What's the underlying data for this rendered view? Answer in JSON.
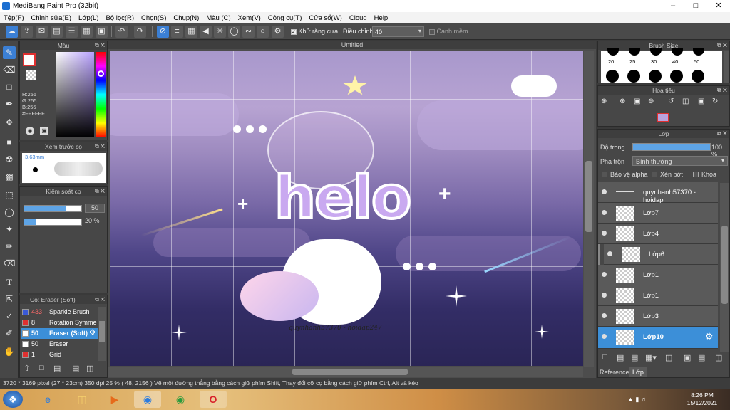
{
  "window": {
    "title": "MediBang Paint Pro (32bit)"
  },
  "menu": [
    "Tệp(F)",
    "Chỉnh sửa(E)",
    "Lớp(L)",
    "Bộ lọc(R)",
    "Chọn(S)",
    "Chụp(N)",
    "Màu (C)",
    "Xem(V)",
    "Công cụ(T)",
    "Cửa sổ(W)",
    "Cloud",
    "Help"
  ],
  "toolbar": {
    "antialias_label": "Khử răng cưa",
    "adjust_label": "Điều chỉnh",
    "adjust_value": "40",
    "snap_label": "Cạnh mềm"
  },
  "color_panel": {
    "title": "Màu",
    "r": "R:255",
    "g": "G:255",
    "b": "B:255",
    "hex": "#FFFFFF",
    "accent": "#e03030"
  },
  "brush_preview": {
    "title": "Xem trước cọ",
    "size": "3.63mm"
  },
  "brush_control": {
    "title": "Kiểm soát cọ",
    "size_value": "50",
    "opacity_value": "20 %"
  },
  "brush_list": {
    "title": "Cọ: Eraser (Soft)",
    "items": [
      {
        "size": "433",
        "name": "Sparkle Brush",
        "color": "#3a5ad8"
      },
      {
        "size": "8",
        "name": "Rotation Symme",
        "color": "#e03030"
      },
      {
        "size": "50",
        "name": "Eraser (Soft)",
        "color": "#ffffff",
        "selected": true
      },
      {
        "size": "50",
        "name": "Eraser",
        "color": "#ffffff"
      },
      {
        "size": "1",
        "name": "Grid",
        "color": "#e03030"
      }
    ]
  },
  "canvas": {
    "title": "Untitled",
    "art_text": "helo",
    "watermark": "quynhanh57370 - hoidap247"
  },
  "brush_size": {
    "title": "Brush Size",
    "sizes": [
      "20",
      "25",
      "30",
      "40",
      "50"
    ]
  },
  "navigator": {
    "title": "Hoa tiêu"
  },
  "layers_panel": {
    "title": "Lớp",
    "opacity_label": "Độ trong",
    "opacity_value": "100 %",
    "opacity_fraction": 1.0,
    "blend_label": "Pha trộn",
    "blend_value": "Bình thường",
    "protect_alpha": "Bảo vệ alpha",
    "clip": "Xén bớt",
    "lock": "Khóa",
    "layers": [
      {
        "name": "quynhanh57370 - hoidap",
        "selected": false
      },
      {
        "name": "Lớp7",
        "selected": false
      },
      {
        "name": "Lớp4",
        "selected": false
      },
      {
        "name": "Lớp6",
        "selected": false
      },
      {
        "name": "Lớp1",
        "selected": false
      },
      {
        "name": "Lớp1",
        "selected": false
      },
      {
        "name": "Lớp3",
        "selected": false
      },
      {
        "name": "Lớp10",
        "selected": true
      }
    ],
    "tabs": [
      "Reference",
      "Lớp"
    ]
  },
  "status": {
    "text": "3720 * 3169 pixel   (27 * 23cm)   350 dpi   25 %   ( 48, 2156 )   Vẽ một đường thẳng bằng cách giữ phím Shift, Thay đổi cỡ cọ bằng cách giữ phím Ctrl, Alt và kéo"
  },
  "taskbar": {
    "time": "8:26 PM",
    "date": "15/12/2021"
  }
}
